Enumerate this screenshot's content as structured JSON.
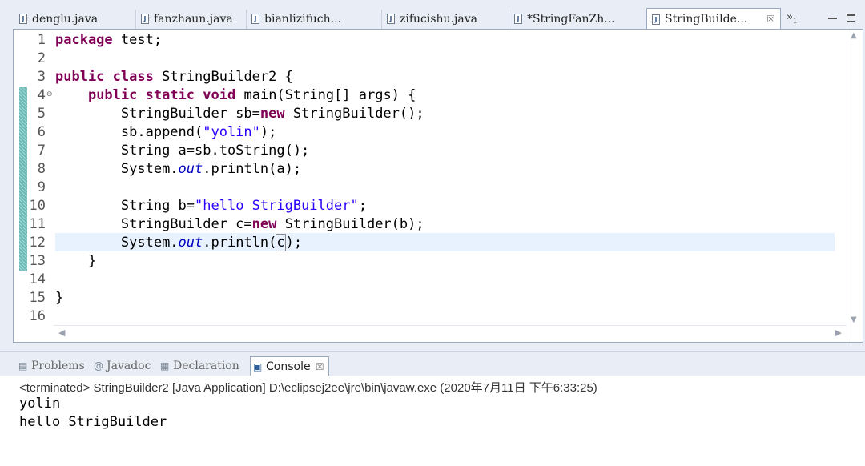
{
  "editor_tabs": [
    {
      "label": "denglu.java",
      "active": false
    },
    {
      "label": "fanzhaun.java",
      "active": false
    },
    {
      "label": "bianlizifuch...",
      "active": false
    },
    {
      "label": "zifucishu.java",
      "active": false
    },
    {
      "label": "*StringFanZh...",
      "active": false
    },
    {
      "label": "StringBuilde...",
      "active": true
    }
  ],
  "overflow": {
    "label": "»",
    "count": "1"
  },
  "code_lines": [
    {
      "num": "1",
      "text": "package test;"
    },
    {
      "num": "2",
      "text": ""
    },
    {
      "num": "3",
      "text": "public class StringBuilder2 {"
    },
    {
      "num": "4",
      "text": "    public static void main(String[] args) {"
    },
    {
      "num": "5",
      "text": "        StringBuilder sb=new StringBuilder();"
    },
    {
      "num": "6",
      "text": "        sb.append(\"yolin\");"
    },
    {
      "num": "7",
      "text": "        String a=sb.toString();"
    },
    {
      "num": "8",
      "text": "        System.out.println(a);"
    },
    {
      "num": "9",
      "text": ""
    },
    {
      "num": "10",
      "text": "        String b=\"hello StrigBuilder\";"
    },
    {
      "num": "11",
      "text": "        StringBuilder c=new StringBuilder(b);"
    },
    {
      "num": "12",
      "text": "        System.out.println(c);"
    },
    {
      "num": "13",
      "text": "    }"
    },
    {
      "num": "14",
      "text": ""
    },
    {
      "num": "15",
      "text": "}"
    },
    {
      "num": "16",
      "text": ""
    }
  ],
  "tokens": {
    "package": "package",
    "public": "public",
    "class": "class",
    "static": "static",
    "void": "void",
    "new": "new",
    "test": " test;",
    "class_decl": " StringBuilder2 {",
    "main_decl": " main(String[] args) {",
    "sb_decl": "StringBuilder sb=",
    "sb_ctor": " StringBuilder();",
    "append_open": "sb.append(",
    "yolin": "\"yolin\"",
    "append_close": ");",
    "a_decl": "String a=sb.toString();",
    "system": "System.",
    "out": "out",
    "println_a": ".println(a);",
    "b_decl": "String b=",
    "hello": "\"hello StrigBuilder\"",
    "semi": ";",
    "c_decl": "StringBuilder c=",
    "c_ctor": " StringBuilder(b);",
    "println_open": ".println(",
    "c_arg": "c",
    "println_close": ");",
    "close_method": "}",
    "close_class": "}"
  },
  "panel": {
    "tabs": [
      {
        "label": "Problems",
        "icon": "problems-icon"
      },
      {
        "label": "Javadoc",
        "icon": "javadoc-icon"
      },
      {
        "label": "Declaration",
        "icon": "declaration-icon"
      },
      {
        "label": "Console",
        "icon": "console-icon",
        "active": true
      }
    ],
    "status": "<terminated> StringBuilder2 [Java Application] D:\\eclipsej2ee\\jre\\bin\\javaw.exe (2020年7月11日 下午6:33:25)",
    "output": [
      "yolin",
      "hello StrigBuilder"
    ]
  }
}
